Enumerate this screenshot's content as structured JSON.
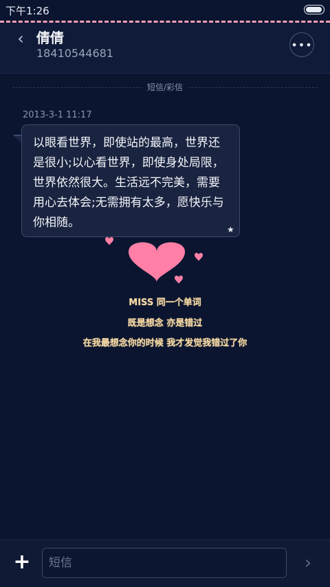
{
  "status_bar": {
    "time": "下午1:26"
  },
  "header": {
    "contact_name": "倩倩",
    "contact_number": "18410544681",
    "back_icon": "chevron-left-icon",
    "more_icon": "more-icon",
    "more_label": "•••"
  },
  "thread": {
    "divider_label": "短信/彩信",
    "messages": [
      {
        "timestamp": "2013-3-1 11:17",
        "text": "以眼看世界，即使站的最高，世界还是很小;以心看世界，即使身处局限，世界依然很大。生活远不完美，需要用心去体会;无需拥有太多，愿快乐与你相随。",
        "star": "★"
      }
    ]
  },
  "decoration": {
    "lines": [
      "MISS 同一个单词",
      "既是想念 亦是错过",
      "在我最想念你的时候 我才发觉我错过了你"
    ],
    "heart_color": "#ff7fa6"
  },
  "composer": {
    "placeholder": "短信",
    "add_icon": "plus-icon",
    "add_label": "+",
    "send_icon": "send-arrow-icon",
    "send_label": "›"
  },
  "colors": {
    "background": "#0b1530",
    "accent_pink": "#ff9fb9",
    "text_gold": "#f4d9a8"
  }
}
